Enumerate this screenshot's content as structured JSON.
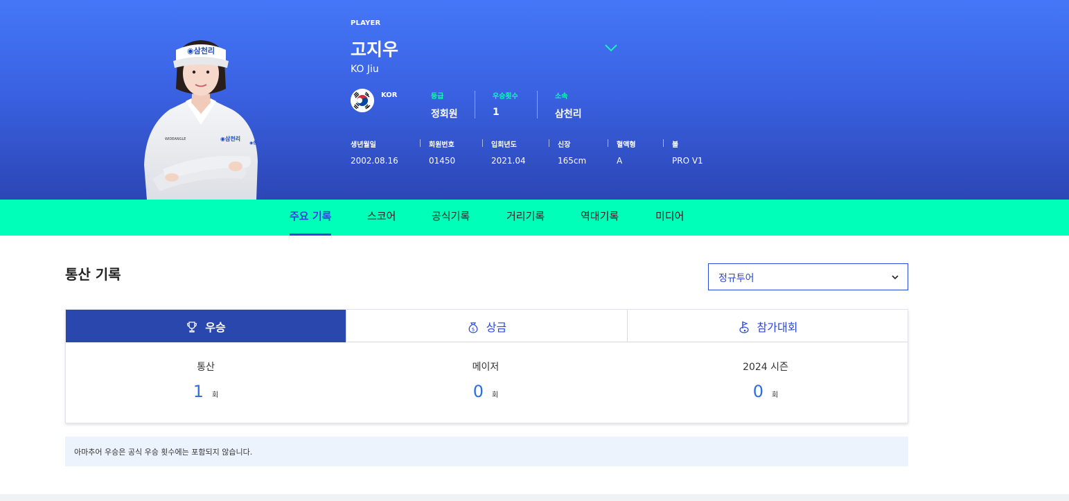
{
  "player": {
    "label": "PLAYER",
    "name_ko": "고지우",
    "name_en": "KO Jiu",
    "nation": "KOR",
    "sponsor_cap_text": "삼천리"
  },
  "primary_info": [
    {
      "label": "등급",
      "value": "정회원"
    },
    {
      "label": "우승횟수",
      "value": "1"
    },
    {
      "label": "소속",
      "value": "삼천리"
    }
  ],
  "meta_info": [
    {
      "label": "생년월일",
      "value": "2002.08.16"
    },
    {
      "label": "회원번호",
      "value": "01450"
    },
    {
      "label": "입회년도",
      "value": "2021.04"
    },
    {
      "label": "신장",
      "value": "165cm"
    },
    {
      "label": "혈액형",
      "value": "A"
    },
    {
      "label": "볼",
      "value": "PRO V1"
    }
  ],
  "tabs": [
    {
      "label": "주요 기록",
      "active": true
    },
    {
      "label": "스코어",
      "active": false
    },
    {
      "label": "공식기록",
      "active": false
    },
    {
      "label": "거리기록",
      "active": false
    },
    {
      "label": "역대기록",
      "active": false
    },
    {
      "label": "미디어",
      "active": false
    }
  ],
  "section": {
    "title": "통산 기록",
    "tour_select": "정규투어"
  },
  "record_tabs": [
    {
      "label": "우승",
      "icon": "trophy-icon",
      "active": true
    },
    {
      "label": "상금",
      "icon": "money-bag-icon",
      "active": false
    },
    {
      "label": "참가대회",
      "icon": "golf-flag-icon",
      "active": false
    }
  ],
  "stats": [
    {
      "label": "통산",
      "value": "1",
      "unit": "회"
    },
    {
      "label": "메이저",
      "value": "0",
      "unit": "회"
    },
    {
      "label": "2024 시즌",
      "value": "0",
      "unit": "회"
    }
  ],
  "notice": "아마추어 우승은 공식 우승 횟수에는 포함되지 않습니다.",
  "colors": {
    "hero_top": "#4477f7",
    "hero_bottom": "#2c46b4",
    "tab_bar": "#00ffb9",
    "accent_blue": "#2a47d8",
    "active_record_tab": "#2a47ad",
    "stat_number": "#2f6de3",
    "info_label": "#16f5b5"
  }
}
